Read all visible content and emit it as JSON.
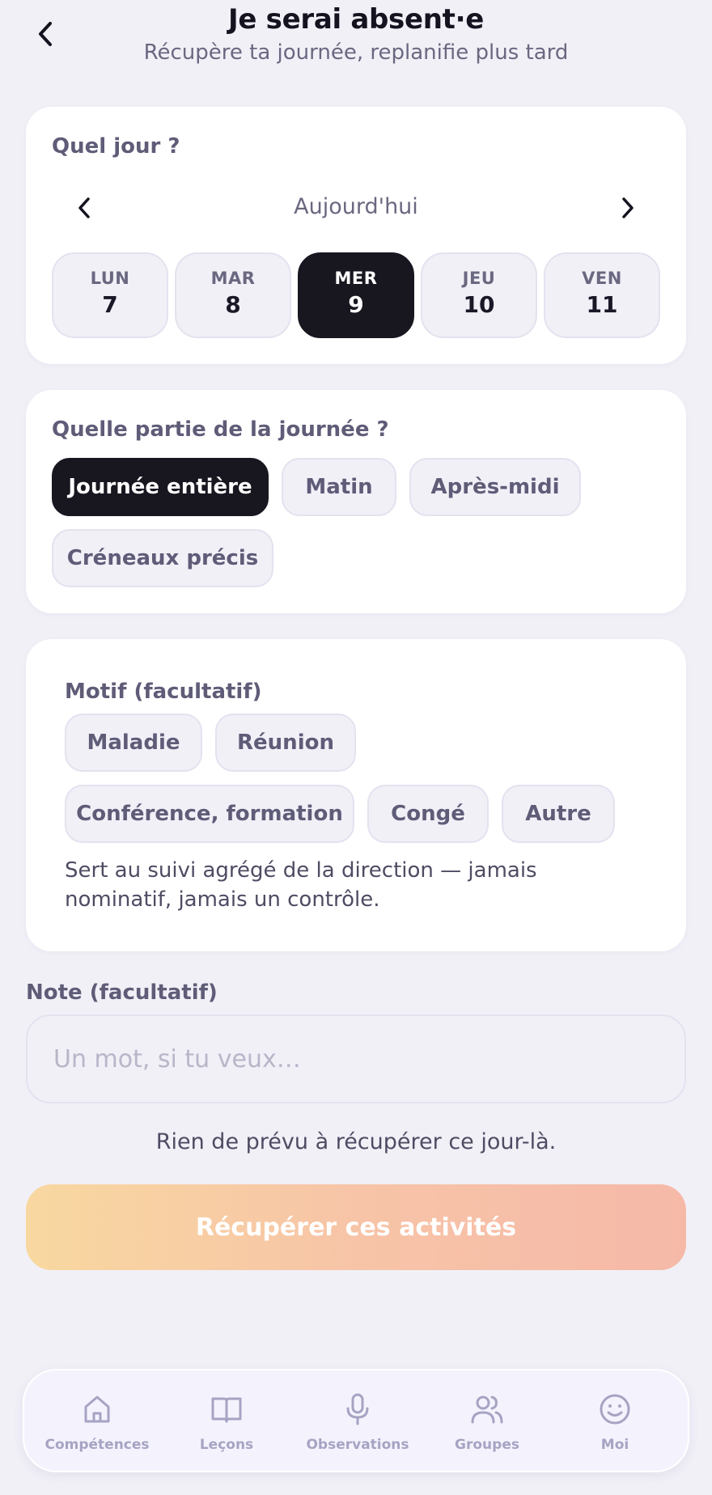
{
  "header": {
    "title": "Je serai absent·e",
    "subtitle": "Récupère ta journée, replanifie plus tard"
  },
  "day_card": {
    "label": "Quel jour ?",
    "current_day_label": "Aujourd'hui",
    "days": [
      {
        "name": "LUN",
        "num": "7",
        "selected": false
      },
      {
        "name": "MAR",
        "num": "8",
        "selected": false
      },
      {
        "name": "MER",
        "num": "9",
        "selected": true
      },
      {
        "name": "JEU",
        "num": "10",
        "selected": false
      },
      {
        "name": "VEN",
        "num": "11",
        "selected": false
      }
    ]
  },
  "part_card": {
    "label": "Quelle partie de la journée ?",
    "options": [
      {
        "label": "Journée entière",
        "selected": true
      },
      {
        "label": "Matin",
        "selected": false
      },
      {
        "label": "Après-midi",
        "selected": false
      },
      {
        "label": "Créneaux précis",
        "selected": false
      }
    ]
  },
  "motif_card": {
    "label": "Motif (facultatif)",
    "options": [
      {
        "label": "Maladie"
      },
      {
        "label": "Réunion"
      },
      {
        "label": "Conférence, formation"
      },
      {
        "label": "Congé"
      },
      {
        "label": "Autre"
      }
    ],
    "help": "Sert au suivi agrégé de la direction — jamais nominatif, jamais un contrôle."
  },
  "note": {
    "label": "Note (facultatif)",
    "placeholder": "Un mot, si tu veux…",
    "value": ""
  },
  "empty_message": "Rien de prévu à récupérer ce jour-là.",
  "primary_button": {
    "label": "Récupérer ces activités",
    "gradient_start": "#f8d8a0",
    "gradient_end": "#f6b9a8"
  },
  "tabbar": {
    "tabs": [
      {
        "label": "Compétences",
        "icon": "home-icon"
      },
      {
        "label": "Leçons",
        "icon": "book-icon"
      },
      {
        "label": "Observations",
        "icon": "microphone-icon"
      },
      {
        "label": "Groupes",
        "icon": "users-icon"
      },
      {
        "label": "Moi",
        "icon": "smiley-icon"
      }
    ]
  },
  "colors": {
    "background": "#f1f0f7",
    "selected": "#18161f",
    "muted_text": "#5f5c78",
    "tab_icon": "#a6a3c3"
  }
}
